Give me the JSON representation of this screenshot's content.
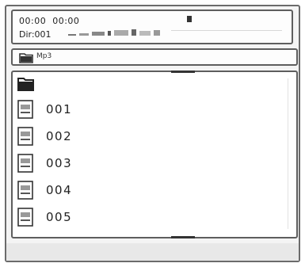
{
  "status": {
    "time_elapsed": "00:00",
    "time_total": "00:00",
    "directory": "Dir:001"
  },
  "path": {
    "label": "Mp3"
  },
  "list": {
    "items": [
      {
        "name": "001"
      },
      {
        "name": "002"
      },
      {
        "name": "003"
      },
      {
        "name": "004"
      },
      {
        "name": "005"
      }
    ]
  }
}
